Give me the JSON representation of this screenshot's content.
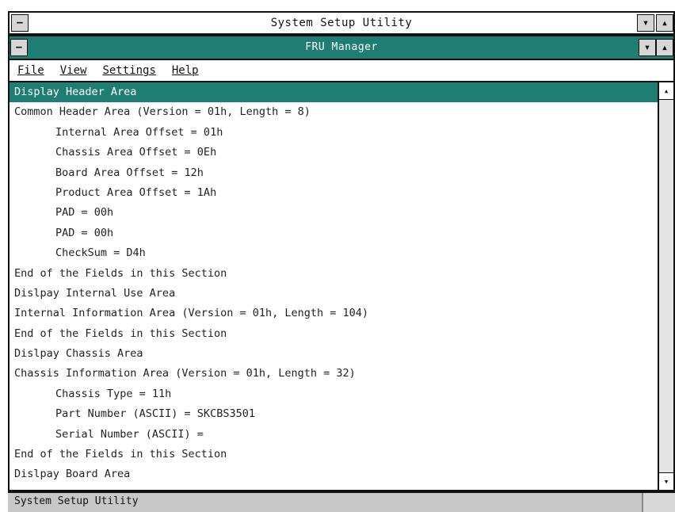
{
  "app": {
    "title": "System Setup Utility",
    "minimize_glyph": "▾",
    "maximize_glyph": "▴",
    "control_glyph": "−"
  },
  "window": {
    "title": "FRU Manager",
    "control_glyph": "−",
    "minimize_glyph": "▾",
    "maximize_glyph": "▴"
  },
  "menu": {
    "items": [
      "File",
      "View",
      "Settings",
      "Help"
    ]
  },
  "content": {
    "lines": [
      {
        "text": "Display Header Area",
        "indent": false,
        "selected": true
      },
      {
        "text": "Common Header Area (Version = 01h, Length = 8)",
        "indent": false,
        "selected": false
      },
      {
        "text": "Internal Area Offset = 01h",
        "indent": true,
        "selected": false
      },
      {
        "text": "Chassis Area Offset = 0Eh",
        "indent": true,
        "selected": false
      },
      {
        "text": "Board Area Offset = 12h",
        "indent": true,
        "selected": false
      },
      {
        "text": "Product Area Offset = 1Ah",
        "indent": true,
        "selected": false
      },
      {
        "text": "PAD = 00h",
        "indent": true,
        "selected": false
      },
      {
        "text": "PAD = 00h",
        "indent": true,
        "selected": false
      },
      {
        "text": "CheckSum = D4h",
        "indent": true,
        "selected": false
      },
      {
        "text": "End of the Fields in this Section",
        "indent": false,
        "selected": false
      },
      {
        "text": "Dislpay Internal Use Area",
        "indent": false,
        "selected": false
      },
      {
        "text": "Internal Information Area (Version = 01h, Length = 104)",
        "indent": false,
        "selected": false
      },
      {
        "text": "End of the Fields in this Section",
        "indent": false,
        "selected": false
      },
      {
        "text": "Dislpay Chassis Area",
        "indent": false,
        "selected": false
      },
      {
        "text": "Chassis Information Area (Version = 01h, Length = 32)",
        "indent": false,
        "selected": false
      },
      {
        "text": "Chassis Type = 11h",
        "indent": true,
        "selected": false
      },
      {
        "text": "Part Number (ASCII) = SKCBS3501",
        "indent": true,
        "selected": false
      },
      {
        "text": "Serial Number (ASCII) =",
        "indent": true,
        "selected": false
      },
      {
        "text": "End of the Fields in this Section",
        "indent": false,
        "selected": false
      },
      {
        "text": "Dislpay Board Area",
        "indent": false,
        "selected": false
      }
    ]
  },
  "scrollbar": {
    "up_glyph": "▴",
    "down_glyph": "▾"
  },
  "status": {
    "text": "System Setup Utility"
  },
  "colors": {
    "accent": "#1e7e73",
    "status_bg": "#c8c8c8"
  }
}
